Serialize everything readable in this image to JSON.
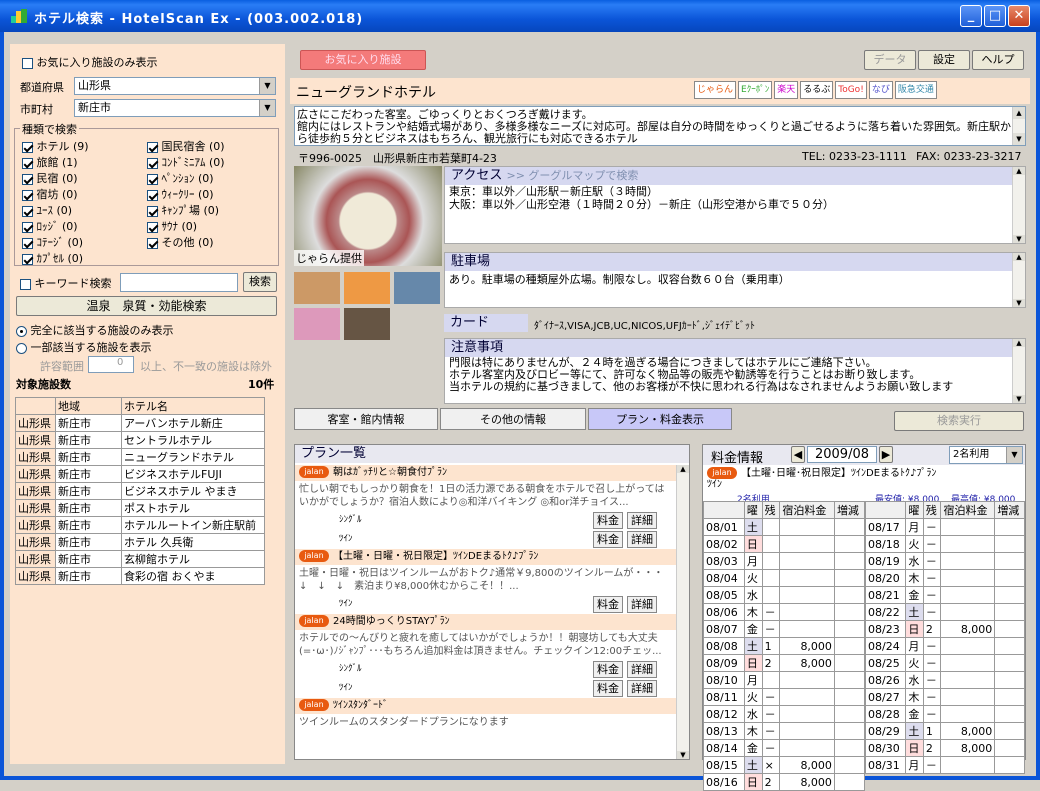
{
  "window": {
    "title": "ホテル検索 - HotelScan Ex - (003.002.018)"
  },
  "left": {
    "fav_only": "お気に入り施設のみ表示",
    "pref_label": "都道府県",
    "pref_value": "山形県",
    "city_label": "市町村",
    "city_value": "新庄市",
    "types_title": "種類で検索",
    "types": [
      {
        "label": "ホテル (9)"
      },
      {
        "label": "国民宿舎 (0)"
      },
      {
        "label": "旅館 (1)"
      },
      {
        "label": "ｺﾝﾄﾞﾐﾆｱﾑ (0)"
      },
      {
        "label": "民宿 (0)"
      },
      {
        "label": "ﾍﾟﾝｼｮﾝ (0)"
      },
      {
        "label": "宿坊 (0)"
      },
      {
        "label": "ｳｨｰｸﾘｰ (0)"
      },
      {
        "label": "ﾕｰｽ (0)"
      },
      {
        "label": "ｷｬﾝﾌﾟ場 (0)"
      },
      {
        "label": "ﾛｯｼﾞ (0)"
      },
      {
        "label": "ｻｳﾅ (0)"
      },
      {
        "label": "ｺﾃｰｼﾞ (0)"
      },
      {
        "label": "その他 (0)"
      },
      {
        "label": "ｶﾌﾟｾﾙ (0)"
      }
    ],
    "keyword_label": "キーワード検索",
    "search_btn": "検索",
    "onsen_btn": "温泉　泉質・効能検索",
    "exact_label": "完全に該当する施設のみ表示",
    "partial_label": "一部該当する施設を表示",
    "tolerance_label": "許容範囲",
    "tolerance_value": "0",
    "tolerance_suffix": "以上、不一致の施設は除外",
    "count_label": "対象施設数",
    "count_value": "10件",
    "table_headers": [
      "地域",
      "ホテル名"
    ],
    "rows": [
      [
        "山形県",
        "新庄市",
        "アーバンホテル新庄"
      ],
      [
        "山形県",
        "新庄市",
        "セントラルホテル"
      ],
      [
        "山形県",
        "新庄市",
        "ニューグランドホテル"
      ],
      [
        "山形県",
        "新庄市",
        "ビジネスホテルFUJI"
      ],
      [
        "山形県",
        "新庄市",
        "ビジネスホテル やまき"
      ],
      [
        "山形県",
        "新庄市",
        "ポストホテル"
      ],
      [
        "山形県",
        "新庄市",
        "ホテルルートイン新庄駅前"
      ],
      [
        "山形県",
        "新庄市",
        "ホテル 久兵衛"
      ],
      [
        "山形県",
        "新庄市",
        "玄柳館ホテル"
      ],
      [
        "山形県",
        "新庄市",
        "食彩の宿 おくやま"
      ]
    ]
  },
  "top": {
    "fav_btn": "お気に入り施設",
    "data_btn": "データ",
    "settings_btn": "設定",
    "help_btn": "ヘルプ"
  },
  "hotel": {
    "name": "ニューグランドホテル",
    "desc": "広さにこだわった客室。ごゆっくりとおくつろぎ戴けます。\n館内にはレストランや結婚式場があり、多様多様なニーズに対応可。部屋は自分の時間をゆっくりと過ごせるように落ち着いた雰囲気。新庄駅から徒歩約５分とビジネスはもちろん、観光旅行にも対応できるホテル",
    "address": "〒996-0025　山形県新庄市若葉町4-23",
    "tel": "TEL: 0233-23-1111",
    "fax": "FAX: 0233-23-3217",
    "photo_caption": "じゃらん提供",
    "access_title": "アクセス",
    "map_link": ">> グーグルマップで検索",
    "access_text": "東京：車以外／山形駅－新庄駅（３時間）\n大阪：車以外／山形空港（１時間２０分）－新庄（山形空港から車で５０分）",
    "parking_title": "駐車場",
    "parking_text": "あり。駐車場の種類屋外広場。制限なし。収容台数６０台（乗用車）",
    "card_title": "カード",
    "card_text": "ﾀﾞｲﾅｰｽ,VISA,JCB,UC,NICOS,UFJｶｰﾄﾞ,ｼﾞｪｲﾃﾞﾋﾞｯﾄ",
    "notes_title": "注意事項",
    "notes_text": "門限は特にありませんが、２４時を過ぎる場合につきましてはホテルにご連絡下さい。\nホテル客室内及びロビー等にて、許可なく物品等の販売や勧誘等を行うことはお断り致します。\n当ホテルの規約に基づきまして、他のお客様が不快に思われる行為はなされませんようお願い致します",
    "logos": [
      "じゃらん",
      "Eｸｰﾎﾟﾝ",
      "楽天",
      "るるぶ",
      "ToGo!",
      "なび",
      "阪急交通"
    ]
  },
  "tabs": {
    "t1": "客室・館内情報",
    "t2": "その他の情報",
    "t3": "プラン・料金表示",
    "exec": "検索実行"
  },
  "plans": {
    "title": "プラン一覧",
    "items": [
      {
        "name": "朝はｶﾞｯﾁﾘと☆朝食付ﾌﾟﾗﾝ",
        "desc": "忙しい朝でもしっかり朝食を！1日の活力源である朝食をホテルで召し上がってはいかがでしょうか？宿泊人数により◎和洋バイキング ◎和or洋チョイス...",
        "rooms": [
          "ｼﾝｸﾞﾙ",
          "ﾂｲﾝ"
        ]
      },
      {
        "name": "【土曜・日曜・祝日限定】ﾂｲﾝDEまるﾄｸ♪ﾌﾟﾗﾝ",
        "desc": "土曜・日曜・祝日はツインルームがおトク♪通常￥9,800のツインルームが・・・　↓　↓　↓　素泊まり¥8,000休むからこそ！！...",
        "rooms": [
          "ﾂｲﾝ"
        ]
      },
      {
        "name": "24時間ゆっくりSTAYﾌﾟﾗﾝ",
        "desc": "ホテルでの～んびりと疲れを癒してはいかがでしょうか！！朝寝坊しても大丈夫(=･ω･)ﾉｼﾞｬﾝﾌﾟ･･･もちろん追加料金は頂きません。チェックイン12:00チェッ...",
        "rooms": [
          "ｼﾝｸﾞﾙ",
          "ﾂｲﾝ"
        ]
      },
      {
        "name": "ﾂｲﾝｽﾀﾝﾀﾞｰﾄﾞ",
        "desc": "ツインルームのスタンダードプランになります",
        "rooms": []
      }
    ],
    "price_btn": "料金",
    "detail_btn": "詳細"
  },
  "rates": {
    "title": "料金情報",
    "month": "2009/08",
    "persons": "2名利用",
    "plan": "【土曜･日曜･祝日限定】ﾂｲﾝDEまるﾄｸ♪ﾌﾟﾗﾝ",
    "room": "ﾂｲﾝ",
    "persons2": "2名利用",
    "min": "最安値: ¥8,000",
    "max": "最高値: ¥8,000",
    "headers": [
      "曜",
      "残",
      "宿泊料金",
      "増減"
    ],
    "left_days": [
      [
        "08/01",
        "土",
        "",
        "",
        ""
      ],
      [
        "08/02",
        "日",
        "",
        "",
        ""
      ],
      [
        "08/03",
        "月",
        "",
        "",
        ""
      ],
      [
        "08/04",
        "火",
        "",
        "",
        ""
      ],
      [
        "08/05",
        "水",
        "",
        "",
        ""
      ],
      [
        "08/06",
        "木",
        "－",
        "",
        ""
      ],
      [
        "08/07",
        "金",
        "－",
        "",
        ""
      ],
      [
        "08/08",
        "土",
        "1",
        "8,000",
        ""
      ],
      [
        "08/09",
        "日",
        "2",
        "8,000",
        ""
      ],
      [
        "08/10",
        "月",
        "",
        "",
        ""
      ],
      [
        "08/11",
        "火",
        "－",
        "",
        ""
      ],
      [
        "08/12",
        "水",
        "－",
        "",
        ""
      ],
      [
        "08/13",
        "木",
        "－",
        "",
        ""
      ],
      [
        "08/14",
        "金",
        "－",
        "",
        ""
      ],
      [
        "08/15",
        "土",
        "×",
        "8,000",
        ""
      ],
      [
        "08/16",
        "日",
        "2",
        "8,000",
        ""
      ]
    ],
    "right_days": [
      [
        "08/17",
        "月",
        "－",
        "",
        ""
      ],
      [
        "08/18",
        "火",
        "－",
        "",
        ""
      ],
      [
        "08/19",
        "水",
        "－",
        "",
        ""
      ],
      [
        "08/20",
        "木",
        "－",
        "",
        ""
      ],
      [
        "08/21",
        "金",
        "－",
        "",
        ""
      ],
      [
        "08/22",
        "土",
        "－",
        "",
        ""
      ],
      [
        "08/23",
        "日",
        "2",
        "8,000",
        ""
      ],
      [
        "08/24",
        "月",
        "－",
        "",
        ""
      ],
      [
        "08/25",
        "火",
        "－",
        "",
        ""
      ],
      [
        "08/26",
        "水",
        "－",
        "",
        ""
      ],
      [
        "08/27",
        "木",
        "－",
        "",
        ""
      ],
      [
        "08/28",
        "金",
        "－",
        "",
        ""
      ],
      [
        "08/29",
        "土",
        "1",
        "8,000",
        ""
      ],
      [
        "08/30",
        "日",
        "2",
        "8,000",
        ""
      ],
      [
        "08/31",
        "月",
        "－",
        "",
        ""
      ]
    ]
  }
}
